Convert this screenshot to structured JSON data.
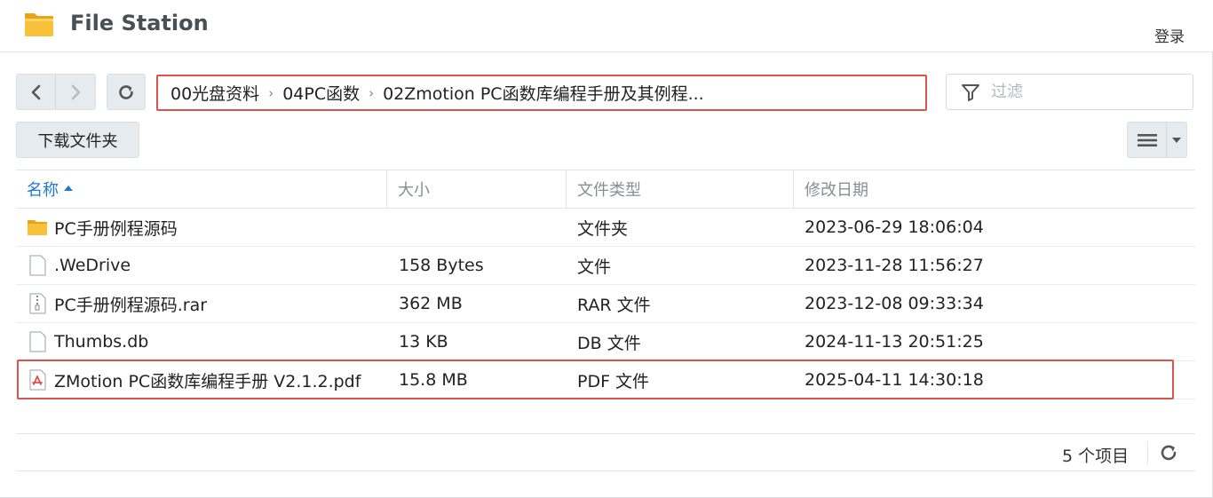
{
  "app": {
    "title": "File Station",
    "login_label": "登录",
    "icon": "folder-app-icon"
  },
  "toolbar": {
    "back_icon": "chevron-left-icon",
    "forward_icon": "chevron-right-icon",
    "refresh_icon": "refresh-icon",
    "download_folder_label": "下载文件夹",
    "filter_placeholder": "过滤",
    "filter_value": "",
    "view_icon": "list-view-icon"
  },
  "breadcrumb": [
    "00光盘资料",
    "04PC函数",
    "02Zmotion PC函数库编程手册及其例程..."
  ],
  "columns": {
    "name": "名称",
    "size": "大小",
    "type": "文件类型",
    "modified": "修改日期",
    "sorted_by": "name",
    "sort_direction": "asc"
  },
  "files": [
    {
      "icon": "folder-icon",
      "name": "PC手册例程源码",
      "size": "",
      "type": "文件夹",
      "modified": "2023-06-29 18:06:04"
    },
    {
      "icon": "file-icon",
      "name": ".WeDrive",
      "size": "158 Bytes",
      "type": "文件",
      "modified": "2023-11-28 11:56:27"
    },
    {
      "icon": "archive-icon",
      "name": "PC手册例程源码.rar",
      "size": "362 MB",
      "type": "RAR 文件",
      "modified": "2023-12-08 09:33:34"
    },
    {
      "icon": "file-icon",
      "name": "Thumbs.db",
      "size": "13 KB",
      "type": "DB 文件",
      "modified": "2024-11-13 20:51:25"
    },
    {
      "icon": "pdf-icon",
      "name": "ZMotion PC函数库编程手册 V2.1.2.pdf",
      "size": "15.8 MB",
      "type": "PDF 文件",
      "modified": "2025-04-11 14:30:18"
    }
  ],
  "footer": {
    "item_count": "5 个项目"
  },
  "colors": {
    "accent": "#1e78d6",
    "highlight_border": "#d9534f",
    "folder": "#f5b826",
    "pdf": "#d9534f"
  }
}
